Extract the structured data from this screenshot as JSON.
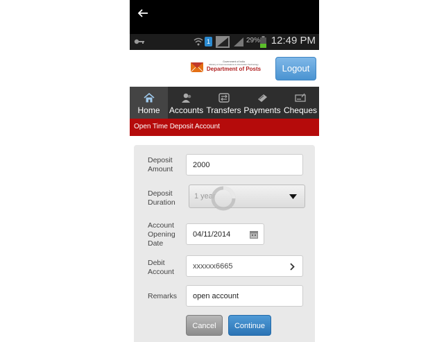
{
  "status_bar": {
    "battery": "29%",
    "time": "12:49 PM",
    "notification_badge": "1"
  },
  "header": {
    "logo_line1": "Government of India",
    "logo_line2": "Ministry of Communications & Information Technology",
    "logo_name": "Department of Posts",
    "logout_label": "Logout"
  },
  "nav": {
    "items": [
      {
        "label": "Home",
        "icon": "home-icon",
        "active": true
      },
      {
        "label": "Accounts",
        "icon": "accounts-icon",
        "active": false
      },
      {
        "label": "Transfers",
        "icon": "transfers-icon",
        "active": false
      },
      {
        "label": "Payments",
        "icon": "payments-icon",
        "active": false
      },
      {
        "label": "Cheques",
        "icon": "cheques-icon",
        "active": false
      }
    ]
  },
  "page_title": "Open Time Deposit Account",
  "form": {
    "deposit_amount": {
      "label_line1": "Deposit",
      "label_line2": "Amount",
      "value": "2000"
    },
    "deposit_duration": {
      "label_line1": "Deposit",
      "label_line2": "Duration",
      "value": "1 year"
    },
    "opening_date": {
      "label_line1": "Account",
      "label_line2": "Opening",
      "label_line3": "Date",
      "value": "04/11/2014"
    },
    "debit_account": {
      "label_line1": "Debit",
      "label_line2": "Account",
      "value": "xxxxxx6665"
    },
    "remarks": {
      "label": "Remarks",
      "value": "open account"
    }
  },
  "buttons": {
    "cancel": "Cancel",
    "continue": "Continue"
  },
  "colors": {
    "title_bar": "#b50b0b",
    "nav_bg": "#2e2e2e",
    "accent_blue": "#2c74b5"
  }
}
